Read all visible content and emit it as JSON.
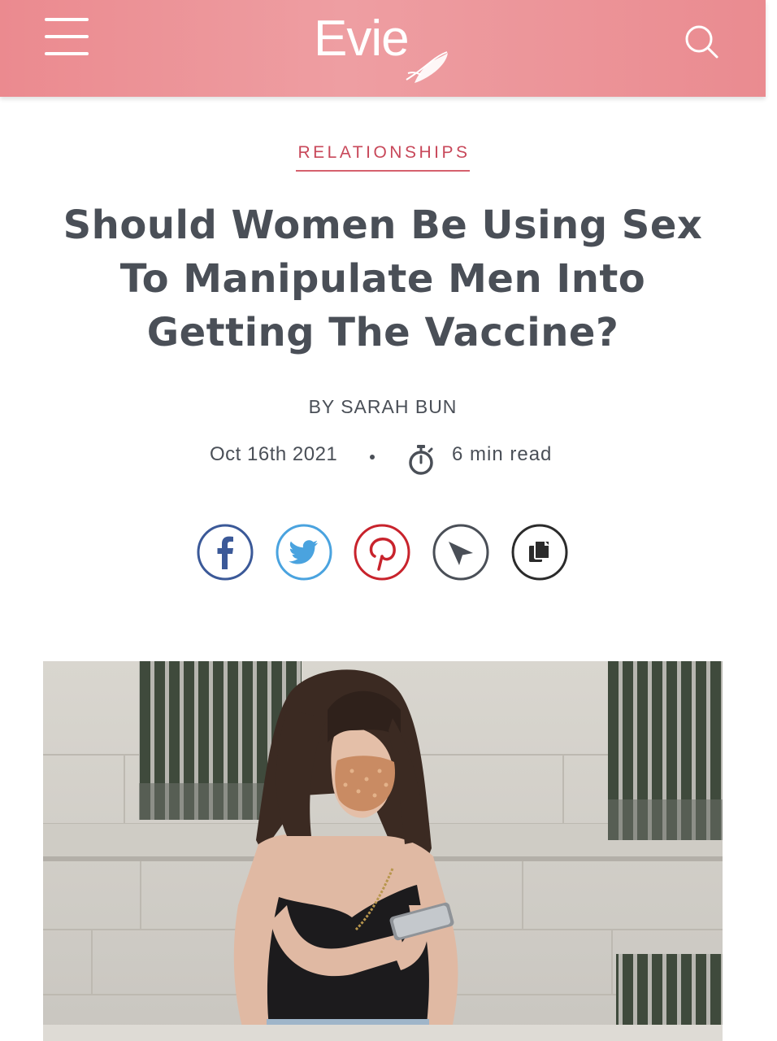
{
  "header": {
    "logo_text": "Evie",
    "colors": {
      "bar": "#eb8a8f",
      "icon": "#ffffff"
    },
    "icons": {
      "menu": "hamburger-menu-icon",
      "search": "search-icon",
      "logo_mark": "feather-icon"
    }
  },
  "article": {
    "category": "RELATIONSHIPS",
    "title": "Should Women Be Using Sex To Manipulate Men Into Getting The Vaccine?",
    "byline": "BY SARAH BUN",
    "date": "Oct 16th 2021",
    "read_time": "6 min read",
    "colors": {
      "category": "#c8485a",
      "text": "#4a4f57"
    }
  },
  "share": {
    "buttons": [
      {
        "network": "facebook",
        "icon": "facebook-icon",
        "color": "#3b5998"
      },
      {
        "network": "twitter",
        "icon": "twitter-icon",
        "color": "#4aa3df"
      },
      {
        "network": "pinterest",
        "icon": "pinterest-icon",
        "color": "#c8232c"
      },
      {
        "network": "send",
        "icon": "send-icon",
        "color": "#4a4f57"
      },
      {
        "network": "copy",
        "icon": "copy-icon",
        "color": "#2b2b2b"
      }
    ]
  },
  "hero_image": {
    "icon": "photo-woman-in-mask-with-phone"
  }
}
